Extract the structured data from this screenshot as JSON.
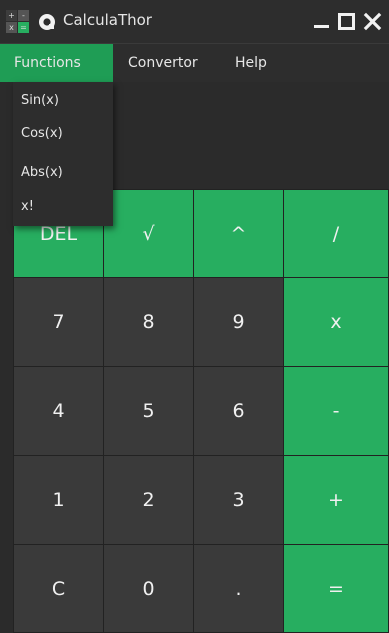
{
  "window": {
    "title": "CalculaThor",
    "icon_name": "calculator-app-icon",
    "icon_glyphs": [
      "+",
      "-",
      "x",
      "="
    ],
    "controls": {
      "minimize_icon": "minimize-icon",
      "maximize_icon": "maximize-icon",
      "close_icon": "close-icon"
    }
  },
  "menu": {
    "items": [
      {
        "label": "Functions",
        "active": true
      },
      {
        "label": "Convertor"
      },
      {
        "label": "Help"
      }
    ]
  },
  "functions_menu": {
    "items": [
      {
        "label": "Sin(x)"
      },
      {
        "label": "Cos(x)"
      },
      {
        "label": "Abs(x)"
      },
      {
        "label": "x!"
      }
    ]
  },
  "display": {
    "value": ""
  },
  "keypad": {
    "rows": [
      [
        {
          "label": "DEL",
          "style": "green"
        },
        {
          "label": "√",
          "style": "green"
        },
        {
          "label": "^",
          "style": "green"
        },
        {
          "label": "/",
          "style": "green"
        }
      ],
      [
        {
          "label": "7",
          "style": "dark"
        },
        {
          "label": "8",
          "style": "dark"
        },
        {
          "label": "9",
          "style": "dark"
        },
        {
          "label": "x",
          "style": "green"
        }
      ],
      [
        {
          "label": "4",
          "style": "dark"
        },
        {
          "label": "5",
          "style": "dark"
        },
        {
          "label": "6",
          "style": "dark"
        },
        {
          "label": "-",
          "style": "green"
        }
      ],
      [
        {
          "label": "1",
          "style": "dark"
        },
        {
          "label": "2",
          "style": "dark"
        },
        {
          "label": "3",
          "style": "dark"
        },
        {
          "label": "+",
          "style": "green"
        }
      ],
      [
        {
          "label": "C",
          "style": "dark"
        },
        {
          "label": "0",
          "style": "dark"
        },
        {
          "label": ".",
          "style": "dark"
        },
        {
          "label": "=",
          "style": "green"
        }
      ]
    ]
  },
  "colors": {
    "accent": "#27ae60",
    "menu_active": "#1f9d55",
    "background": "#2b2b2b",
    "key_dark": "#3a3a3a",
    "text": "#f0f0f0"
  }
}
